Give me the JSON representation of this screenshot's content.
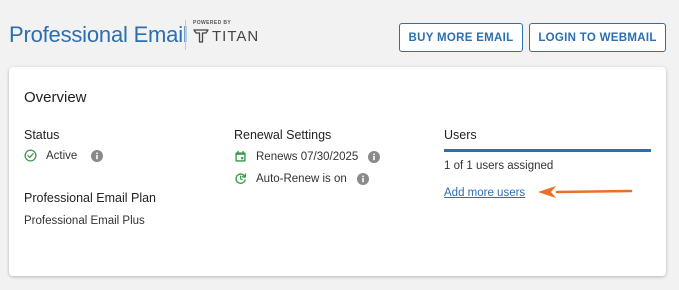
{
  "header": {
    "title": "Professional Email",
    "powered_by": "POWERED BY",
    "brand_name": "TITAN",
    "buy_button": "BUY MORE EMAIL",
    "login_button": "LOGIN TO WEBMAIL"
  },
  "overview": {
    "title": "Overview",
    "status": {
      "label": "Status",
      "value": "Active",
      "icon": "check-circle-icon"
    },
    "plan": {
      "label": "Professional Email Plan",
      "value": "Professional Email Plus"
    },
    "renewal": {
      "label": "Renewal Settings",
      "renews": "Renews 07/30/2025",
      "auto_renew": "Auto-Renew is on"
    },
    "users": {
      "label": "Users",
      "assigned": "1 of 1 users assigned",
      "add_link": "Add more users"
    }
  },
  "colors": {
    "accent": "#2a6fb0",
    "success": "#3c9a4e",
    "annotation_arrow": "#e8702a",
    "info_icon": "#8a8a8a"
  }
}
